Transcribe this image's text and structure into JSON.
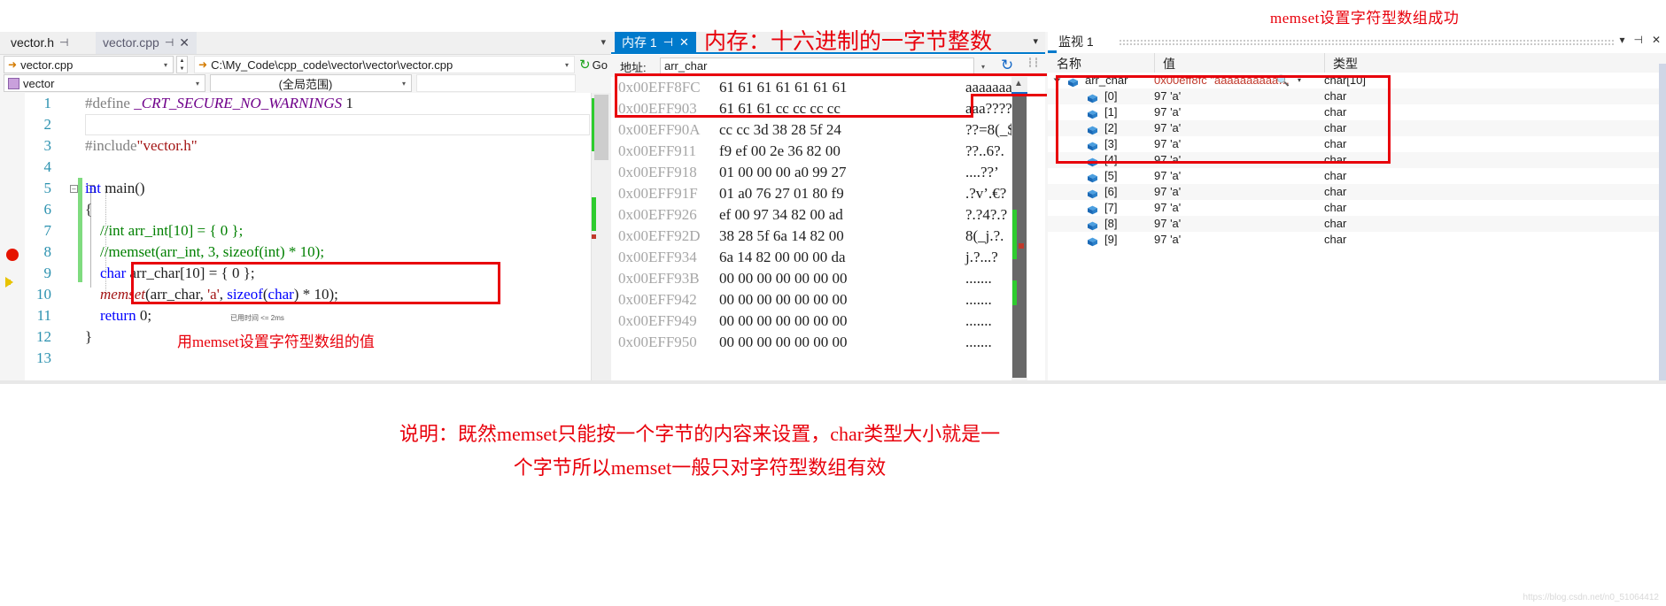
{
  "annotations": {
    "top_right": "memset设置字符型数组成功",
    "memory_title": "内存：十六进制的一字节整数",
    "code_under": "用memset设置字符型数组的值",
    "bottom_line1": "说明：既然memset只能按一个字节的内容来设置，char类型大小就是一",
    "bottom_line2": "个字节所以memset一般只对字符型数组有效",
    "watermark": "https://blog.csdn.net/n0_51064412"
  },
  "editor": {
    "tabs": [
      {
        "label": "vector.h",
        "pin": "⊣",
        "active": false
      },
      {
        "label": "vector.cpp",
        "pin": "⊣",
        "close": "✕",
        "active": true
      }
    ],
    "nav": {
      "project_combo": "vector.cpp",
      "file_path": "C:\\My_Code\\cpp_code\\vector\\vector\\vector.cpp",
      "go_label": "Go",
      "scope_combo": "vector",
      "member_combo": "(全局范围)",
      "third_combo": ""
    },
    "elapsed_badge": "已用时间 <= 2ms",
    "lines": [
      {
        "n": "1",
        "tokens": [
          {
            "t": "#define ",
            "c": "pp"
          },
          {
            "t": "_CRT_SECURE_NO_WARNINGS",
            "c": "macro"
          },
          {
            "t": " 1",
            "c": "plain"
          }
        ]
      },
      {
        "n": "2",
        "tokens": []
      },
      {
        "n": "3",
        "tokens": [
          {
            "t": "#include",
            "c": "pp"
          },
          {
            "t": "\"vector.h\"",
            "c": "str"
          }
        ]
      },
      {
        "n": "4",
        "tokens": []
      },
      {
        "n": "5",
        "tokens": [
          {
            "t": "int",
            "c": "kw"
          },
          {
            "t": " ",
            "c": "plain"
          },
          {
            "t": "main",
            "c": "plain"
          },
          {
            "t": "()",
            "c": "plain"
          }
        ]
      },
      {
        "n": "6",
        "tokens": [
          {
            "t": "{",
            "c": "plain"
          }
        ]
      },
      {
        "n": "7",
        "tokens": [
          {
            "t": "    //int arr_int[10] = { 0 };",
            "c": "cmt"
          }
        ]
      },
      {
        "n": "8",
        "tokens": [
          {
            "t": "    //memset(arr_int, 3, sizeof(int) * 10);",
            "c": "cmt"
          }
        ]
      },
      {
        "n": "9",
        "tokens": [
          {
            "t": "    ",
            "c": "plain"
          },
          {
            "t": "char",
            "c": "kw"
          },
          {
            "t": " arr_char[",
            "c": "plain"
          },
          {
            "t": "10",
            "c": "plain"
          },
          {
            "t": "] = { ",
            "c": "plain"
          },
          {
            "t": "0",
            "c": "plain"
          },
          {
            "t": " };",
            "c": "plain"
          }
        ]
      },
      {
        "n": "10",
        "tokens": [
          {
            "t": "    ",
            "c": "plain"
          },
          {
            "t": "memset",
            "c": "func"
          },
          {
            "t": "(arr_char, ",
            "c": "plain"
          },
          {
            "t": "'a'",
            "c": "str"
          },
          {
            "t": ", ",
            "c": "plain"
          },
          {
            "t": "sizeof",
            "c": "kw"
          },
          {
            "t": "(",
            "c": "plain"
          },
          {
            "t": "char",
            "c": "kw"
          },
          {
            "t": ") * ",
            "c": "plain"
          },
          {
            "t": "10",
            "c": "plain"
          },
          {
            "t": ");",
            "c": "plain"
          }
        ]
      },
      {
        "n": "11",
        "tokens": [
          {
            "t": "    ",
            "c": "plain"
          },
          {
            "t": "return",
            "c": "kw"
          },
          {
            "t": " ",
            "c": "plain"
          },
          {
            "t": "0",
            "c": "plain"
          },
          {
            "t": ";",
            "c": "plain"
          }
        ]
      },
      {
        "n": "12",
        "tokens": [
          {
            "t": "}",
            "c": "plain"
          }
        ]
      },
      {
        "n": "13",
        "tokens": []
      }
    ]
  },
  "memory": {
    "tab_label": "内存 1",
    "tab_pin": "⊣",
    "tab_close": "✕",
    "address_label": "地址:",
    "address_value": "arr_char",
    "rows": [
      {
        "addr": "0x00EFF8FC",
        "hex": "61 61 61 61 61 61 61",
        "ascii": "aaaaaaa"
      },
      {
        "addr": "0x00EFF903",
        "hex": "61 61 61 cc cc cc cc",
        "ascii": "aaa????"
      },
      {
        "addr": "0x00EFF90A",
        "hex": "cc cc 3d 38 28 5f 24",
        "ascii": "??=8(_$"
      },
      {
        "addr": "0x00EFF911",
        "hex": "f9 ef 00 2e 36 82 00",
        "ascii": "??..6?."
      },
      {
        "addr": "0x00EFF918",
        "hex": "01 00 00 00 a0 99 27",
        "ascii": "....??’"
      },
      {
        "addr": "0x00EFF91F",
        "hex": "01 a0 76 27 01 80 f9",
        "ascii": ".?v’.€?"
      },
      {
        "addr": "0x00EFF926",
        "hex": "ef 00 97 34 82 00 ad",
        "ascii": "?.?4?.?"
      },
      {
        "addr": "0x00EFF92D",
        "hex": "38 28 5f 6a 14 82 00",
        "ascii": "8(_j.?."
      },
      {
        "addr": "0x00EFF934",
        "hex": "6a 14 82 00 00 00 da",
        "ascii": "j.?...?"
      },
      {
        "addr": "0x00EFF93B",
        "hex": "00 00 00 00 00 00 00",
        "ascii": "......."
      },
      {
        "addr": "0x00EFF942",
        "hex": "00 00 00 00 00 00 00",
        "ascii": "......."
      },
      {
        "addr": "0x00EFF949",
        "hex": "00 00 00 00 00 00 00",
        "ascii": "......."
      },
      {
        "addr": "0x00EFF950",
        "hex": "00 00 00 00 00 00 00",
        "ascii": "......."
      }
    ]
  },
  "watch": {
    "tab_label": "监视 1",
    "columns": {
      "name": "名称",
      "value": "值",
      "type": "类型"
    },
    "rows": [
      {
        "name": "arr_char",
        "value": "0x00eff8fc \"aaaaaaaaaa…",
        "type": "char[10]",
        "root": true,
        "has_magnifier": true
      },
      {
        "name": "[0]",
        "value": "97 'a'",
        "type": "char"
      },
      {
        "name": "[1]",
        "value": "97 'a'",
        "type": "char"
      },
      {
        "name": "[2]",
        "value": "97 'a'",
        "type": "char"
      },
      {
        "name": "[3]",
        "value": "97 'a'",
        "type": "char"
      },
      {
        "name": "[4]",
        "value": "97 'a'",
        "type": "char"
      },
      {
        "name": "[5]",
        "value": "97 'a'",
        "type": "char"
      },
      {
        "name": "[6]",
        "value": "97 'a'",
        "type": "char"
      },
      {
        "name": "[7]",
        "value": "97 'a'",
        "type": "char"
      },
      {
        "name": "[8]",
        "value": "97 'a'",
        "type": "char"
      },
      {
        "name": "[9]",
        "value": "97 'a'",
        "type": "char"
      }
    ],
    "controls": {
      "dropdown": "▾",
      "pin": "⊣",
      "close": "✕"
    }
  },
  "colors": {
    "annotation_red": "#e8000b",
    "vs_blue": "#007acc",
    "keyword_blue": "#0000ff",
    "comment_green": "#008000",
    "string_red": "#a31515",
    "macro_purple": "#6f008a",
    "changebar_green": "#7fdb7f",
    "breakpoint_red": "#e51400"
  }
}
